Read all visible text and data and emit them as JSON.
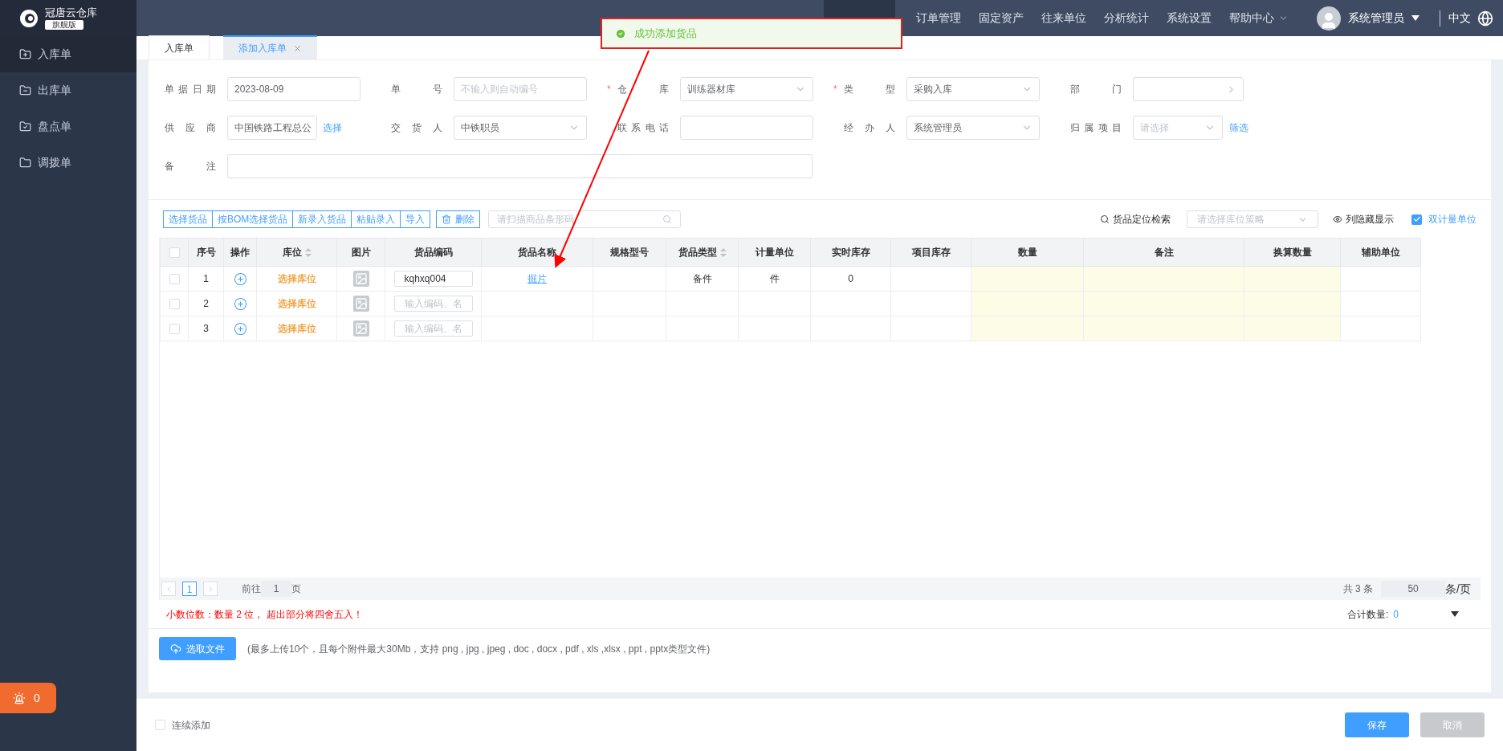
{
  "app": {
    "name": "冠唐云仓库",
    "edition": "旗舰版"
  },
  "sidebar": {
    "items": [
      {
        "label": "入库单",
        "kind": "in",
        "selected": true
      },
      {
        "label": "出库单",
        "kind": "out",
        "selected": false
      },
      {
        "label": "盘点单",
        "kind": "check",
        "selected": false
      },
      {
        "label": "调拨单",
        "kind": "move",
        "selected": false
      }
    ],
    "badge": "0"
  },
  "nav": {
    "items": [
      {
        "label": "订单管理",
        "kind": "plain"
      },
      {
        "label": "固定资产",
        "kind": "plain"
      },
      {
        "label": "往来单位",
        "kind": "plain"
      },
      {
        "label": "分析统计",
        "kind": "plain"
      },
      {
        "label": "系统设置",
        "kind": "plain"
      },
      {
        "label": "帮助中心",
        "kind": "dropdown"
      }
    ],
    "user": "系统管理员",
    "language": "中文"
  },
  "toast": {
    "message": "成功添加货品"
  },
  "tabs": [
    {
      "label": "入库单",
      "selected": false,
      "closable": false
    },
    {
      "label": "添加入库单",
      "selected": true,
      "closable": true
    }
  ],
  "form": {
    "fields": [
      {
        "label": "单据日期",
        "kind": "text",
        "value": "2023-08-09"
      },
      {
        "label": "单号",
        "kind": "text",
        "placeholder": "不输入则自动编号"
      },
      {
        "label": "仓库",
        "kind": "select",
        "value": "训练器材库",
        "required_mark": "*"
      },
      {
        "label": "类型",
        "kind": "select",
        "value": "采购入库",
        "required_mark": "*"
      },
      {
        "label": "部门",
        "kind": "cascader"
      },
      {
        "label": "供应商",
        "kind": "link",
        "value": "中国铁路工程总公",
        "link": "选择"
      },
      {
        "label": "交货人",
        "kind": "select",
        "value": "中铁职员"
      },
      {
        "label": "联系电话",
        "kind": "text"
      },
      {
        "label": "经办人",
        "kind": "select",
        "value": "系统管理员"
      },
      {
        "label": "归属项目",
        "kind": "selectlink",
        "placeholder": "请选择",
        "link": "筛选"
      },
      {
        "label": "备注",
        "kind": "wide"
      }
    ]
  },
  "toolbar": {
    "buttons": [
      "选择货品",
      "按BOM选择货品",
      "新录入货品",
      "粘贴录入",
      "导入"
    ],
    "delete": "删除",
    "scan": {
      "placeholder": "请扫描商品条形码"
    },
    "locate": "货品定位检索",
    "strategy": {
      "placeholder": "请选择库位策略"
    },
    "toggle_columns": "列隐藏显示",
    "dual_unit": {
      "label": "双计量单位",
      "checked": true
    }
  },
  "table": {
    "header_checked": false,
    "columns": [
      {
        "label": "序号",
        "sortable": false,
        "editable": false
      },
      {
        "label": "操作",
        "sortable": false,
        "editable": false
      },
      {
        "label": "库位",
        "sortable": true,
        "editable": false
      },
      {
        "label": "图片",
        "sortable": false,
        "editable": false
      },
      {
        "label": "货品编码",
        "sortable": false,
        "editable": false
      },
      {
        "label": "货品名称",
        "sortable": false,
        "editable": false
      },
      {
        "label": "规格型号",
        "sortable": false,
        "editable": false
      },
      {
        "label": "货品类型",
        "sortable": true,
        "editable": false
      },
      {
        "label": "计量单位",
        "sortable": false,
        "editable": false
      },
      {
        "label": "实时库存",
        "sortable": false,
        "editable": false
      },
      {
        "label": "项目库存",
        "sortable": false,
        "editable": false
      },
      {
        "label": "数量",
        "sortable": false,
        "editable": true
      },
      {
        "label": "备注",
        "sortable": false,
        "editable": true
      },
      {
        "label": "换算数量",
        "sortable": false,
        "editable": true
      },
      {
        "label": "辅助单位",
        "sortable": false,
        "editable": false
      }
    ],
    "rows": [
      {
        "checked": false,
        "index": "1",
        "location": "选择库位",
        "code": "kqhxq004",
        "name": "掘片",
        "category": "备件",
        "unit": "件",
        "stock": "0"
      },
      {
        "checked": false,
        "index": "2",
        "location": "选择库位",
        "code_placeholder": "输入编码、名"
      },
      {
        "checked": false,
        "index": "3",
        "location": "选择库位",
        "code_placeholder": "输入编码、名"
      }
    ]
  },
  "pagination": {
    "current": "1",
    "goto_label": "前往",
    "goto_value": "1",
    "goto_suffix": "页",
    "total": "共 3 条",
    "page_size": "50",
    "page_size_suffix": "条/页"
  },
  "note": "小数位数：数量 2 位， 超出部分将四舍五入！",
  "summary": {
    "label": "合计数量:",
    "value": "0"
  },
  "upload": {
    "button": "选取文件",
    "hint": "(最多上传10个，且每个附件最大30Mb，支持 png , jpg , jpeg , doc , docx , pdf , xls ,xlsx , ppt , pptx类型文件)"
  },
  "footer": {
    "continuous_add": {
      "label": "连续添加",
      "checked": false
    },
    "save": "保存",
    "cancel": {
      "label": "取消",
      "disabled": true
    }
  }
}
